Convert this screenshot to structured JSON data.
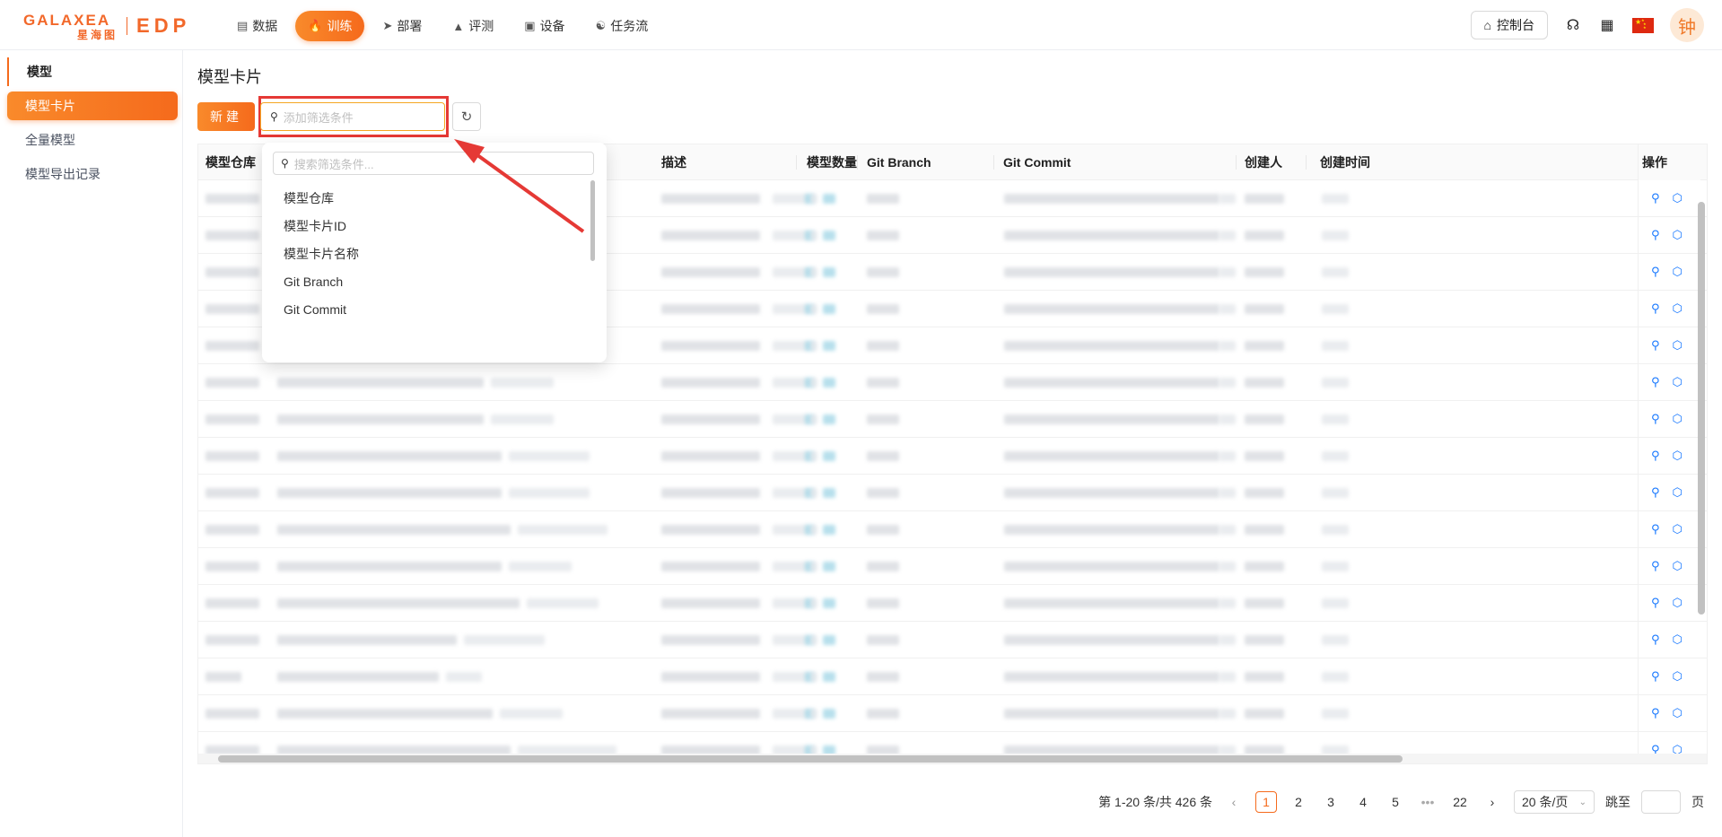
{
  "brand": {
    "word": "GALAXEA",
    "cn": "星海图",
    "product": "EDP"
  },
  "nav": [
    {
      "label": "数据",
      "icon": "database-icon"
    },
    {
      "label": "训练",
      "icon": "fire-icon"
    },
    {
      "label": "部署",
      "icon": "rocket-icon"
    },
    {
      "label": "评测",
      "icon": "flask-icon"
    },
    {
      "label": "设备",
      "icon": "robot-icon"
    },
    {
      "label": "任务流",
      "icon": "workflow-icon"
    }
  ],
  "header": {
    "console_label": "控制台",
    "avatar_text": "钟"
  },
  "sidebar": {
    "group": "模型",
    "items": [
      {
        "label": "模型卡片"
      },
      {
        "label": "全量模型"
      },
      {
        "label": "模型导出记录"
      }
    ]
  },
  "main": {
    "title": "模型卡片",
    "new_button": "新建",
    "filter_placeholder": "添加筛选条件"
  },
  "table": {
    "columns": [
      "模型仓库",
      "描述",
      "模型数量",
      "Git Branch",
      "Git Commit",
      "创建人",
      "创建时间",
      "操作"
    ]
  },
  "dropdown": {
    "search_placeholder": "搜索筛选条件...",
    "options": [
      "模型仓库",
      "模型卡片ID",
      "模型卡片名称",
      "Git Branch",
      "Git Commit"
    ]
  },
  "pagination": {
    "summary": "第 1-20 条/共 426 条",
    "pages": [
      "1",
      "2",
      "3",
      "4",
      "5",
      "•••",
      "22"
    ],
    "current": "1",
    "page_size": "20 条/页",
    "jump_label": "跳至",
    "page_unit": "页"
  },
  "colors": {
    "accent": "#f56a1c",
    "highlight": "#e53935",
    "link": "#1677ff"
  }
}
